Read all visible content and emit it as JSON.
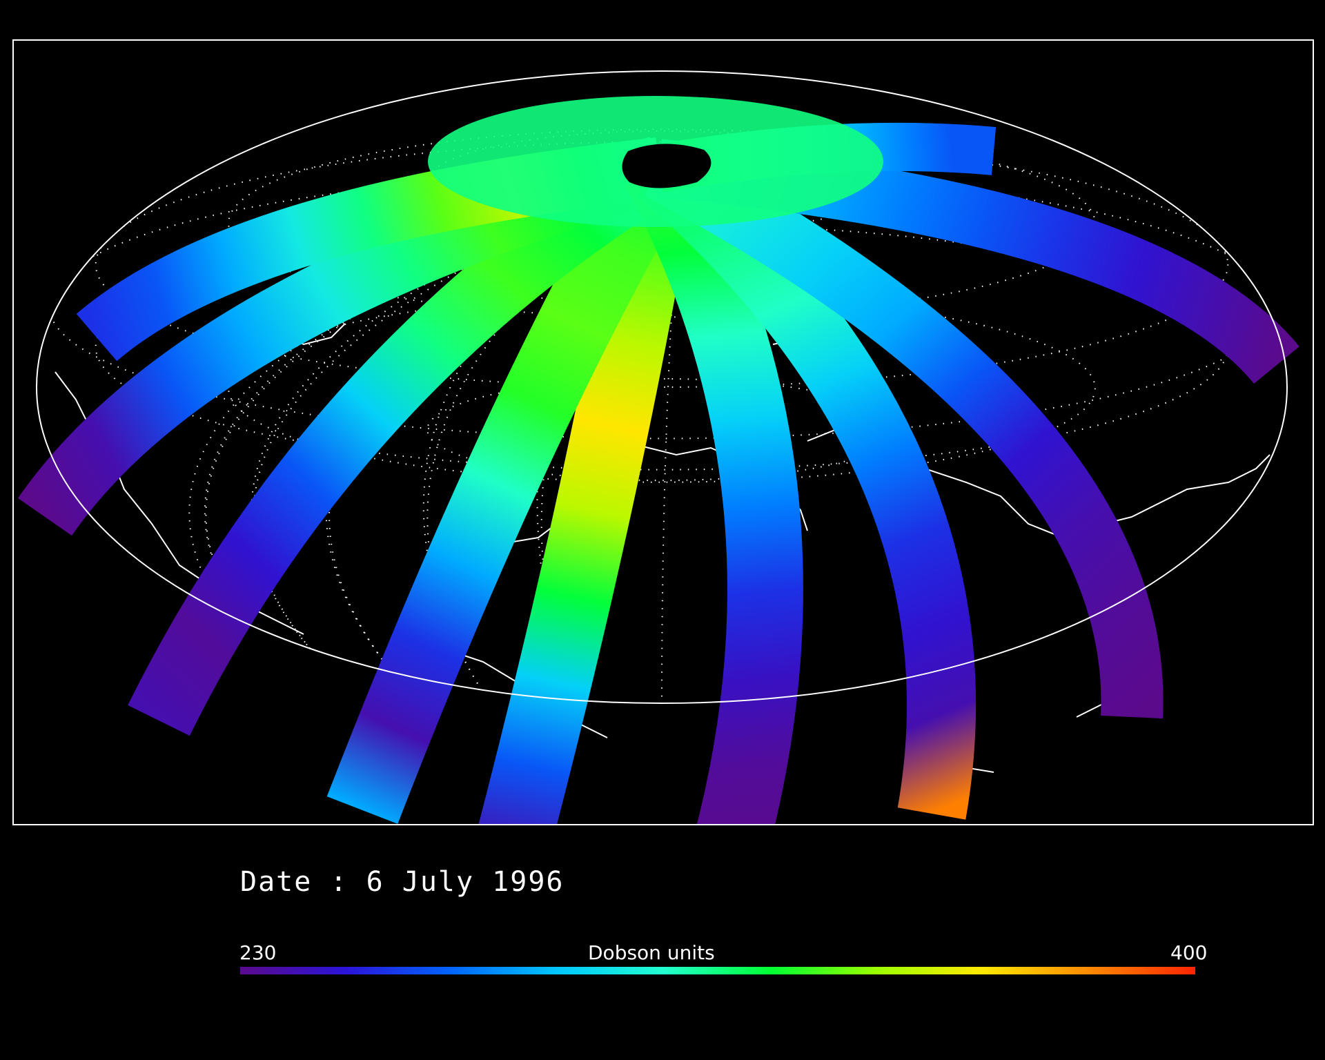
{
  "date_label": "Date : 6 July 1996",
  "colorbar": {
    "min_label": "230",
    "max_label": "400",
    "title": "Dobson units",
    "min": 230,
    "max": 400,
    "stops": [
      "#5b0a8c",
      "#2b14d9",
      "#0066ff",
      "#00c8ff",
      "#22ffcf",
      "#00ff33",
      "#9cff00",
      "#ffe800",
      "#ff8a00",
      "#ff2400"
    ]
  },
  "map": {
    "projection": "tilted orthographic / hammer-style globe",
    "background": "#000000",
    "coastline_color": "#ffffff",
    "graticule": "dotted"
  }
}
